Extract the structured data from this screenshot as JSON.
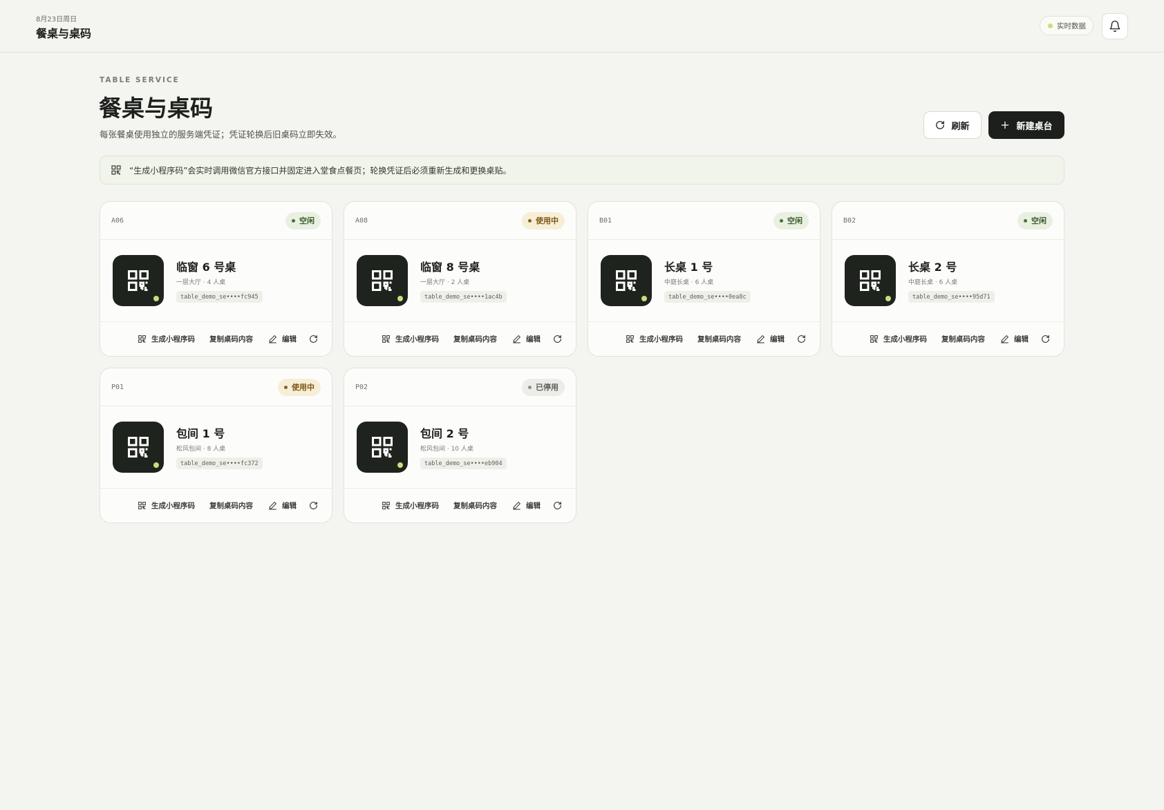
{
  "header": {
    "date": "8月23日周日",
    "title": "餐桌与桌码",
    "live_label": "实时数据"
  },
  "hero": {
    "eyebrow": "TABLE SERVICE",
    "title": "餐桌与桌码",
    "subtitle": "每张餐桌使用独立的服务端凭证；凭证轮换后旧桌码立即失效。",
    "refresh_label": "刷新",
    "new_label": "新建桌台"
  },
  "notice": {
    "text": "“生成小程序码”会实时调用微信官方接口并固定进入堂食点餐页；轮换凭证后必须重新生成和更换桌贴。"
  },
  "actions": {
    "generate": "生成小程序码",
    "copy": "复制桌码内容",
    "edit": "编辑"
  },
  "tables": [
    {
      "code": "A06",
      "status": "空闲",
      "status_type": "idle",
      "name": "临窗 6 号桌",
      "meta": "一层大厅 · 4 人桌",
      "token": "table_demo_se••••fc945"
    },
    {
      "code": "A08",
      "status": "使用中",
      "status_type": "busy",
      "name": "临窗 8 号桌",
      "meta": "一层大厅 · 2 人桌",
      "token": "table_demo_se••••1ac4b"
    },
    {
      "code": "B01",
      "status": "空闲",
      "status_type": "idle",
      "name": "长桌 1 号",
      "meta": "中庭长桌 · 6 人桌",
      "token": "table_demo_se••••0ea8c"
    },
    {
      "code": "B02",
      "status": "空闲",
      "status_type": "idle",
      "name": "长桌 2 号",
      "meta": "中庭长桌 · 6 人桌",
      "token": "table_demo_se••••95d71"
    },
    {
      "code": "P01",
      "status": "使用中",
      "status_type": "busy",
      "name": "包间 1 号",
      "meta": "松风包间 · 8 人桌",
      "token": "table_demo_se••••fc372"
    },
    {
      "code": "P02",
      "status": "已停用",
      "status_type": "off",
      "name": "包间 2 号",
      "meta": "松风包间 · 10 人桌",
      "token": "table_demo_se••••eb904"
    }
  ],
  "colors": {
    "accent_dark": "#1c1f1b",
    "live_green": "#c5e07a",
    "idle": "#4a7238",
    "busy": "#8a6420",
    "disabled": "#8c8e89"
  },
  "icons": {
    "bell": "bell-icon",
    "refresh": "refresh-icon",
    "plus": "plus-icon",
    "qr": "qr-code-icon",
    "edit": "pencil-icon",
    "rotate": "rotate-icon"
  }
}
